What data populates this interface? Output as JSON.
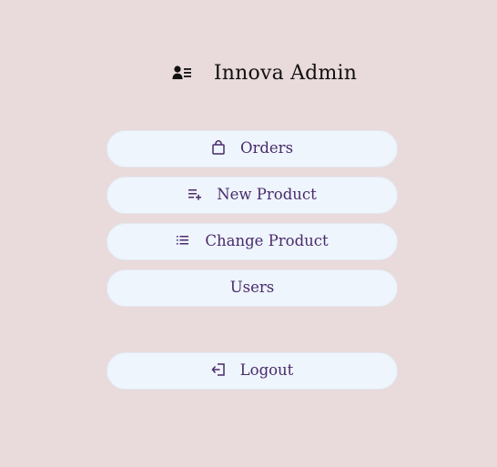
{
  "header": {
    "title": "Innova Admin",
    "icon": "user-list-icon"
  },
  "menu": {
    "items": [
      {
        "label": "Orders",
        "icon": "shopping-bag-icon"
      },
      {
        "label": "New Product",
        "icon": "playlist-add-icon"
      },
      {
        "label": "Change Product",
        "icon": "list-icon"
      },
      {
        "label": "Users",
        "icon": ""
      }
    ],
    "logout": {
      "label": "Logout",
      "icon": "logout-icon"
    }
  },
  "colors": {
    "background": "#e9dadb",
    "button_bg": "#eef5fd",
    "button_text": "#4a2a6a",
    "title_text": "#111111"
  }
}
